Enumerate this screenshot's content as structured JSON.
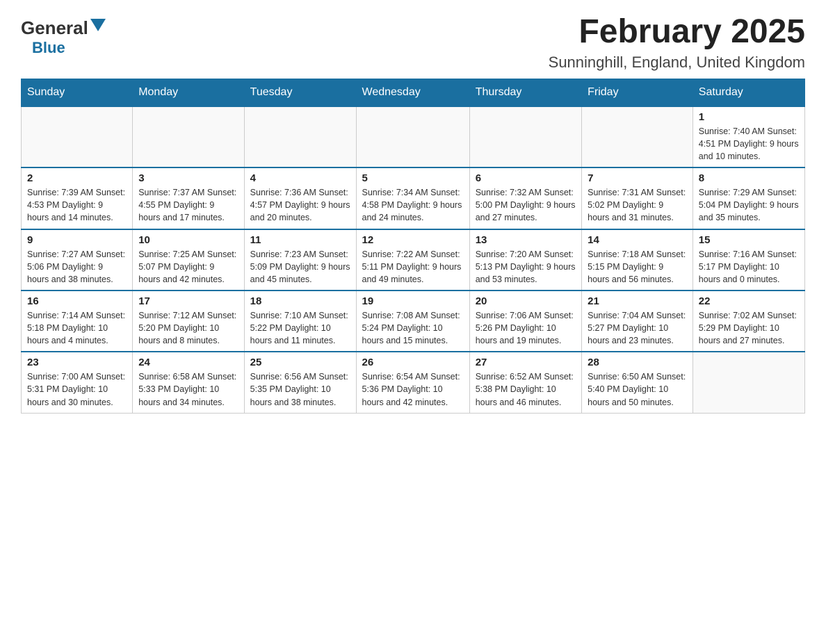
{
  "header": {
    "logo_general": "General",
    "logo_blue": "Blue",
    "month_year": "February 2025",
    "location": "Sunninghill, England, United Kingdom"
  },
  "days_of_week": [
    "Sunday",
    "Monday",
    "Tuesday",
    "Wednesday",
    "Thursday",
    "Friday",
    "Saturday"
  ],
  "weeks": [
    [
      {
        "day": "",
        "info": ""
      },
      {
        "day": "",
        "info": ""
      },
      {
        "day": "",
        "info": ""
      },
      {
        "day": "",
        "info": ""
      },
      {
        "day": "",
        "info": ""
      },
      {
        "day": "",
        "info": ""
      },
      {
        "day": "1",
        "info": "Sunrise: 7:40 AM\nSunset: 4:51 PM\nDaylight: 9 hours and 10 minutes."
      }
    ],
    [
      {
        "day": "2",
        "info": "Sunrise: 7:39 AM\nSunset: 4:53 PM\nDaylight: 9 hours and 14 minutes."
      },
      {
        "day": "3",
        "info": "Sunrise: 7:37 AM\nSunset: 4:55 PM\nDaylight: 9 hours and 17 minutes."
      },
      {
        "day": "4",
        "info": "Sunrise: 7:36 AM\nSunset: 4:57 PM\nDaylight: 9 hours and 20 minutes."
      },
      {
        "day": "5",
        "info": "Sunrise: 7:34 AM\nSunset: 4:58 PM\nDaylight: 9 hours and 24 minutes."
      },
      {
        "day": "6",
        "info": "Sunrise: 7:32 AM\nSunset: 5:00 PM\nDaylight: 9 hours and 27 minutes."
      },
      {
        "day": "7",
        "info": "Sunrise: 7:31 AM\nSunset: 5:02 PM\nDaylight: 9 hours and 31 minutes."
      },
      {
        "day": "8",
        "info": "Sunrise: 7:29 AM\nSunset: 5:04 PM\nDaylight: 9 hours and 35 minutes."
      }
    ],
    [
      {
        "day": "9",
        "info": "Sunrise: 7:27 AM\nSunset: 5:06 PM\nDaylight: 9 hours and 38 minutes."
      },
      {
        "day": "10",
        "info": "Sunrise: 7:25 AM\nSunset: 5:07 PM\nDaylight: 9 hours and 42 minutes."
      },
      {
        "day": "11",
        "info": "Sunrise: 7:23 AM\nSunset: 5:09 PM\nDaylight: 9 hours and 45 minutes."
      },
      {
        "day": "12",
        "info": "Sunrise: 7:22 AM\nSunset: 5:11 PM\nDaylight: 9 hours and 49 minutes."
      },
      {
        "day": "13",
        "info": "Sunrise: 7:20 AM\nSunset: 5:13 PM\nDaylight: 9 hours and 53 minutes."
      },
      {
        "day": "14",
        "info": "Sunrise: 7:18 AM\nSunset: 5:15 PM\nDaylight: 9 hours and 56 minutes."
      },
      {
        "day": "15",
        "info": "Sunrise: 7:16 AM\nSunset: 5:17 PM\nDaylight: 10 hours and 0 minutes."
      }
    ],
    [
      {
        "day": "16",
        "info": "Sunrise: 7:14 AM\nSunset: 5:18 PM\nDaylight: 10 hours and 4 minutes."
      },
      {
        "day": "17",
        "info": "Sunrise: 7:12 AM\nSunset: 5:20 PM\nDaylight: 10 hours and 8 minutes."
      },
      {
        "day": "18",
        "info": "Sunrise: 7:10 AM\nSunset: 5:22 PM\nDaylight: 10 hours and 11 minutes."
      },
      {
        "day": "19",
        "info": "Sunrise: 7:08 AM\nSunset: 5:24 PM\nDaylight: 10 hours and 15 minutes."
      },
      {
        "day": "20",
        "info": "Sunrise: 7:06 AM\nSunset: 5:26 PM\nDaylight: 10 hours and 19 minutes."
      },
      {
        "day": "21",
        "info": "Sunrise: 7:04 AM\nSunset: 5:27 PM\nDaylight: 10 hours and 23 minutes."
      },
      {
        "day": "22",
        "info": "Sunrise: 7:02 AM\nSunset: 5:29 PM\nDaylight: 10 hours and 27 minutes."
      }
    ],
    [
      {
        "day": "23",
        "info": "Sunrise: 7:00 AM\nSunset: 5:31 PM\nDaylight: 10 hours and 30 minutes."
      },
      {
        "day": "24",
        "info": "Sunrise: 6:58 AM\nSunset: 5:33 PM\nDaylight: 10 hours and 34 minutes."
      },
      {
        "day": "25",
        "info": "Sunrise: 6:56 AM\nSunset: 5:35 PM\nDaylight: 10 hours and 38 minutes."
      },
      {
        "day": "26",
        "info": "Sunrise: 6:54 AM\nSunset: 5:36 PM\nDaylight: 10 hours and 42 minutes."
      },
      {
        "day": "27",
        "info": "Sunrise: 6:52 AM\nSunset: 5:38 PM\nDaylight: 10 hours and 46 minutes."
      },
      {
        "day": "28",
        "info": "Sunrise: 6:50 AM\nSunset: 5:40 PM\nDaylight: 10 hours and 50 minutes."
      },
      {
        "day": "",
        "info": ""
      }
    ]
  ]
}
